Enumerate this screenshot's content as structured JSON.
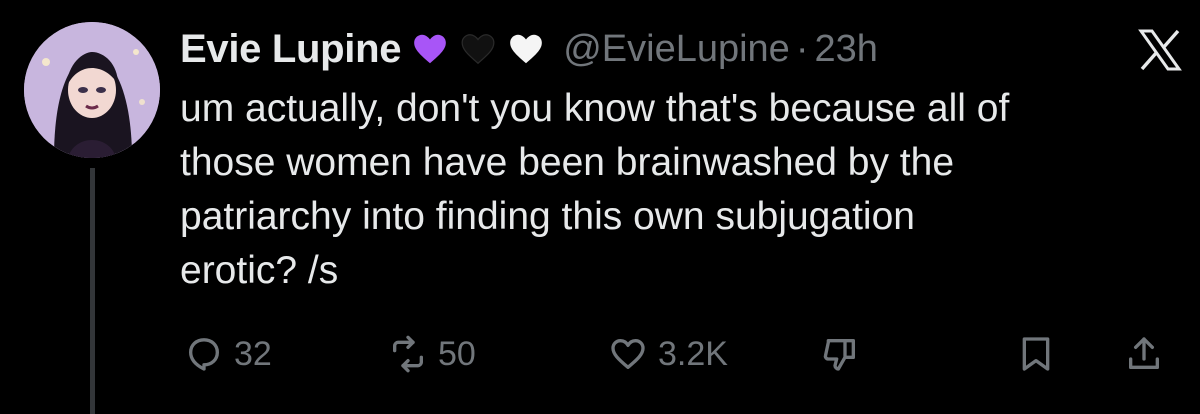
{
  "author": {
    "display_name": "Evie Lupine",
    "handle": "@EvieLupine",
    "separator": "·",
    "time": "23h",
    "badges": [
      "purple-heart-icon",
      "black-heart-icon",
      "white-heart-icon"
    ]
  },
  "tweet": {
    "lines": [
      "um actually, don't you know that's because all of",
      "those women have been brainwashed by the",
      "patriarchy into finding this own subjugation",
      "erotic? /s"
    ]
  },
  "actions": {
    "replies": "32",
    "reposts": "50",
    "likes": "3.2K"
  },
  "colors": {
    "background": "#000000",
    "text": "#e7e9ea",
    "secondary": "#71767b",
    "purple_heart": "#a855f7"
  }
}
